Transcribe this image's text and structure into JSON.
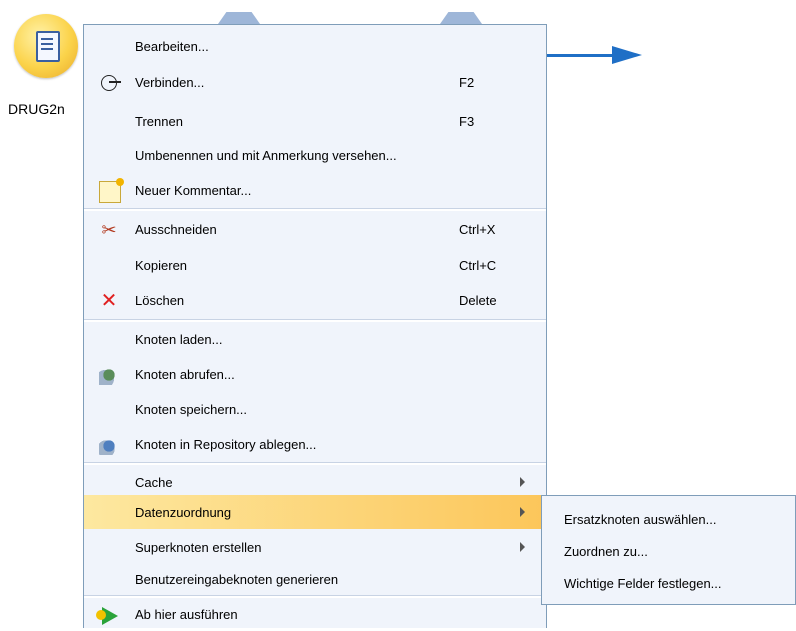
{
  "canvas": {
    "node_label": "DRUG2n"
  },
  "main_menu": {
    "items": [
      {
        "label": "Bearbeiten...",
        "shortcut": ""
      },
      {
        "label": "Verbinden...",
        "shortcut": "F2"
      },
      {
        "label": "Trennen",
        "shortcut": "F3"
      },
      {
        "label": "Umbenennen und mit Anmerkung versehen...",
        "shortcut": ""
      },
      {
        "label": "Neuer Kommentar...",
        "shortcut": ""
      },
      {
        "label": "Ausschneiden",
        "shortcut": "Ctrl+X"
      },
      {
        "label": "Kopieren",
        "shortcut": "Ctrl+C"
      },
      {
        "label": "Löschen",
        "shortcut": "Delete"
      },
      {
        "label": "Knoten laden...",
        "shortcut": ""
      },
      {
        "label": "Knoten abrufen...",
        "shortcut": ""
      },
      {
        "label": "Knoten speichern...",
        "shortcut": ""
      },
      {
        "label": "Knoten in Repository ablegen...",
        "shortcut": ""
      },
      {
        "label": "Cache",
        "shortcut": ""
      },
      {
        "label": "Datenzuordnung",
        "shortcut": ""
      },
      {
        "label": "Superknoten erstellen",
        "shortcut": ""
      },
      {
        "label": "Benutzereingabeknoten generieren",
        "shortcut": ""
      },
      {
        "label": "Ab hier ausführen",
        "shortcut": ""
      }
    ]
  },
  "sub_menu": {
    "items": [
      {
        "label": "Ersatzknoten auswählen..."
      },
      {
        "label": "Zuordnen zu..."
      },
      {
        "label": "Wichtige Felder festlegen..."
      }
    ]
  },
  "colors": {
    "menu_bg": "#f0f4fb",
    "menu_border": "#7f9db9",
    "highlight": "#fcc65a",
    "connector": "#1f6fc6"
  }
}
